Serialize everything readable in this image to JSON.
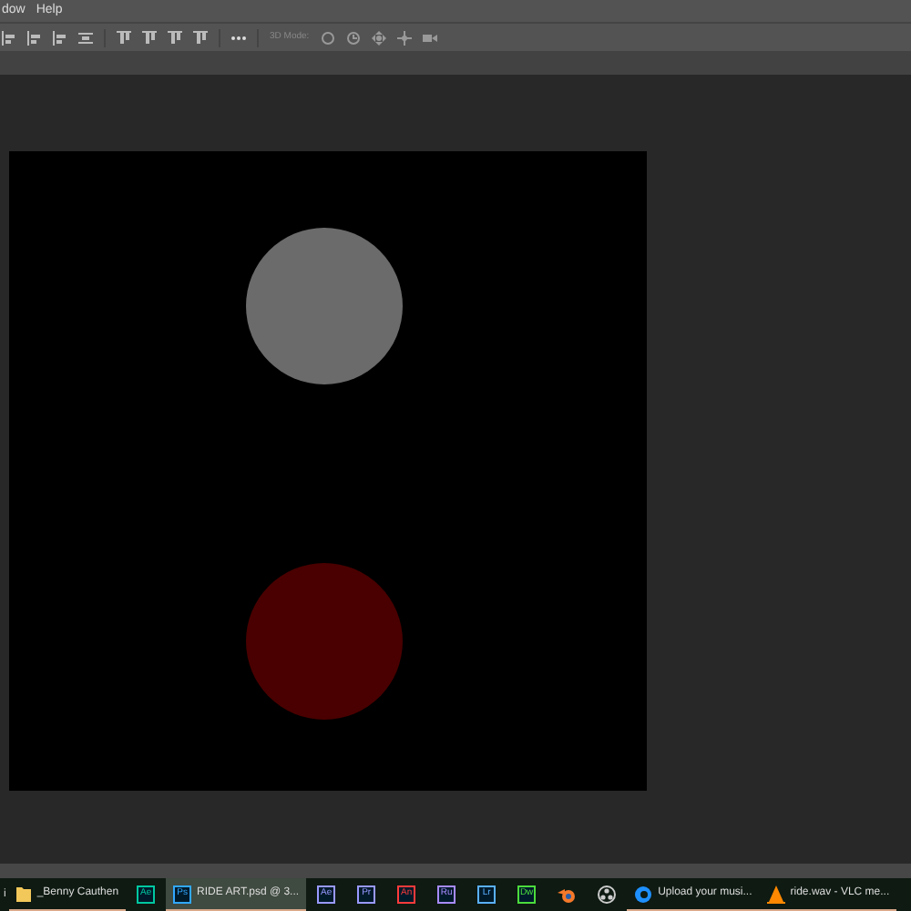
{
  "menu": [
    "dow",
    "Help"
  ],
  "toolbar": {
    "mode_label": "3D Mode:"
  },
  "canvas": {
    "shapes": [
      {
        "kind": "circle",
        "color": "#6b6b6b"
      },
      {
        "kind": "circle",
        "color": "#4a0000"
      }
    ]
  },
  "taskbar": [
    {
      "kind": "cut",
      "label": "i",
      "selected": false
    },
    {
      "kind": "folder",
      "label": "_Benny Cauthen",
      "selected": false
    },
    {
      "kind": "app",
      "icon": "Ae",
      "color": "#00c8a0",
      "selected": false
    },
    {
      "kind": "app",
      "icon": "Ps",
      "color": "#31a8ff",
      "label": "RIDE ART.psd @ 3...",
      "selected": true
    },
    {
      "kind": "app",
      "icon": "Ae",
      "color": "#9999ff",
      "selected": false
    },
    {
      "kind": "app",
      "icon": "Pr",
      "color": "#9999ff",
      "selected": false
    },
    {
      "kind": "app",
      "icon": "An",
      "color": "#ff3b3b",
      "selected": false
    },
    {
      "kind": "app",
      "icon": "Ru",
      "color": "#a78bff",
      "selected": false
    },
    {
      "kind": "app",
      "icon": "Lr",
      "color": "#5ab0ff",
      "selected": false
    },
    {
      "kind": "app",
      "icon": "Dw",
      "color": "#4cdc3c",
      "selected": false
    },
    {
      "kind": "blender",
      "selected": false
    },
    {
      "kind": "obs",
      "selected": false
    },
    {
      "kind": "edge",
      "label": "Upload your musi...",
      "selected": false
    },
    {
      "kind": "vlc",
      "label": "ride.wav - VLC me...",
      "selected": false
    }
  ]
}
